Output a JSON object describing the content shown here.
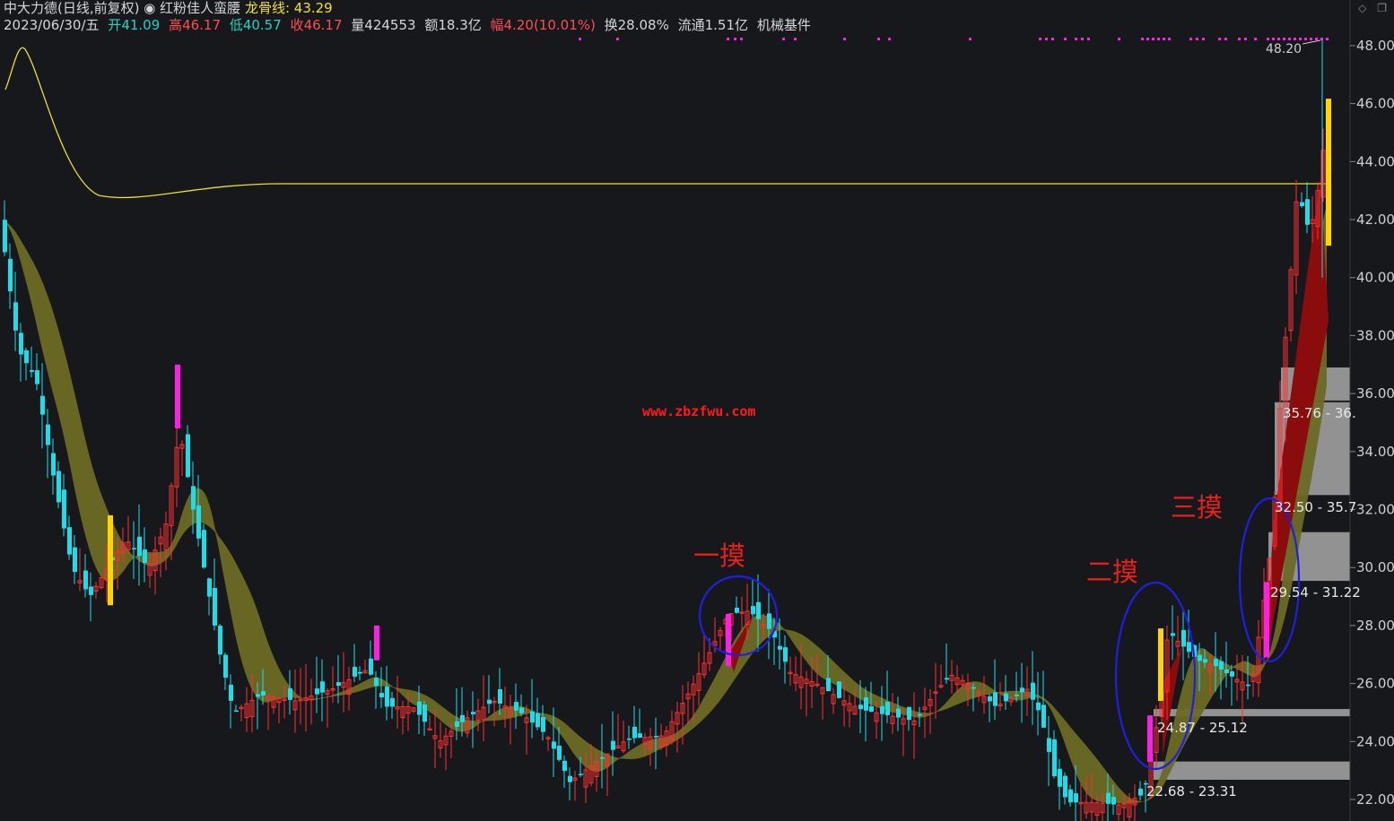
{
  "header": {
    "stock": "中大力德(日线,前复权)",
    "indicator_name": "红粉佳人蛮腰",
    "dragon_label": "龙骨线:",
    "dragon_value": "43.29",
    "date": "2023/06/30/五",
    "open_label": "开",
    "open": "41.09",
    "high_label": "高",
    "high": "46.17",
    "low_label": "低",
    "low": "40.57",
    "close_label": "收",
    "close": "46.17",
    "volume": "量424553",
    "amount": "额18.3亿",
    "change_label": "幅",
    "change": "4.20(10.01%)",
    "turnover": "换28.08%",
    "float_cap": "流通1.51亿",
    "industry": "机械基件"
  },
  "watermark": "www.zbzfwu.com",
  "annotations": [
    "一摸",
    "二摸",
    "三摸"
  ],
  "zone_labels": [
    "22.68 - 23.31",
    "24.87 - 25.12",
    "29.54 - 31.22",
    "32.50 - 35.7",
    "35.76 - 36."
  ],
  "peak_label": "48.20",
  "colors": {
    "background": "#17181c",
    "up_candle": "#ff3030",
    "down_candle": "#1fdde8",
    "ribbon": "#6b6a24",
    "ribbon_red": "#8a0c0c",
    "dragon_line": "#e8e030",
    "signal_magenta": "#ff1ee8",
    "signal_yellow": "#ffd400",
    "zone_gray": "#a8a8a8",
    "circle_blue": "#1f1fe0",
    "annotation_red": "#e8201c"
  },
  "chart_data": {
    "type": "candlestick",
    "y_axis_ticks": [
      "22.00",
      "24.00",
      "26.00",
      "28.00",
      "30.00",
      "32.00",
      "34.00",
      "36.00",
      "38.00",
      "40.00",
      "42.00",
      "44.00",
      "46.00",
      "48.00"
    ],
    "ylim": [
      21.5,
      49.5
    ],
    "dragon_line_value": 43.29,
    "last_bar": {
      "date": "2023/06/30",
      "open": 41.09,
      "high": 46.17,
      "low": 40.57,
      "close": 46.17
    },
    "peak_high": 48.2,
    "support_zones": [
      [
        22.68,
        23.31
      ],
      [
        24.87,
        25.12
      ],
      [
        29.54,
        31.22
      ],
      [
        32.5,
        35.7
      ],
      [
        35.76,
        36.9
      ]
    ],
    "close_path": [
      [
        0,
        42.0
      ],
      [
        20,
        37.5
      ],
      [
        40,
        36.5
      ],
      [
        60,
        33.0
      ],
      [
        80,
        30.0
      ],
      [
        100,
        29.0
      ],
      [
        120,
        30.0
      ],
      [
        140,
        31.0
      ],
      [
        165,
        30.0
      ],
      [
        185,
        31.5
      ],
      [
        200,
        34.8
      ],
      [
        215,
        32.0
      ],
      [
        230,
        29.5
      ],
      [
        245,
        27.0
      ],
      [
        260,
        25.0
      ],
      [
        290,
        25.6
      ],
      [
        330,
        25.4
      ],
      [
        370,
        25.8
      ],
      [
        410,
        26.5
      ],
      [
        430,
        25.2
      ],
      [
        460,
        25.2
      ],
      [
        490,
        24.0
      ],
      [
        520,
        24.8
      ],
      [
        550,
        25.4
      ],
      [
        580,
        25.0
      ],
      [
        610,
        24.2
      ],
      [
        635,
        22.6
      ],
      [
        665,
        23.3
      ],
      [
        700,
        24.1
      ],
      [
        740,
        24.2
      ],
      [
        770,
        25.8
      ],
      [
        790,
        27.0
      ],
      [
        812,
        28.4
      ],
      [
        835,
        28.5
      ],
      [
        860,
        27.8
      ],
      [
        880,
        26.4
      ],
      [
        910,
        26.0
      ],
      [
        935,
        25.5
      ],
      [
        960,
        25.1
      ],
      [
        990,
        24.9
      ],
      [
        1020,
        24.7
      ],
      [
        1045,
        25.8
      ],
      [
        1060,
        26.3
      ],
      [
        1080,
        26.0
      ],
      [
        1110,
        25.2
      ],
      [
        1145,
        25.8
      ],
      [
        1160,
        24.9
      ],
      [
        1175,
        22.8
      ],
      [
        1190,
        21.9
      ],
      [
        1220,
        21.9
      ],
      [
        1250,
        21.8
      ],
      [
        1275,
        22.2
      ],
      [
        1282,
        23.4
      ],
      [
        1293,
        25.1
      ],
      [
        1302,
        27.8
      ],
      [
        1318,
        27.3
      ],
      [
        1335,
        26.8
      ],
      [
        1355,
        26.6
      ],
      [
        1375,
        26.2
      ],
      [
        1395,
        25.9
      ],
      [
        1412,
        29.5
      ],
      [
        1419,
        31.4
      ],
      [
        1428,
        36.0
      ],
      [
        1437,
        39.5
      ],
      [
        1446,
        43.0
      ],
      [
        1460,
        41.5
      ],
      [
        1472,
        43.5
      ],
      [
        1481,
        46.17
      ]
    ],
    "signals": [
      {
        "x": 123,
        "kind": "yellow",
        "low": 28.7,
        "high": 31.8
      },
      {
        "x": 198,
        "kind": "magenta",
        "low": 34.8,
        "high": 37.0
      },
      {
        "x": 420,
        "kind": "magenta",
        "low": 26.8,
        "high": 28.0
      },
      {
        "x": 812,
        "kind": "magenta",
        "low": 26.6,
        "high": 28.4
      },
      {
        "x": 1282,
        "kind": "magenta",
        "low": 23.3,
        "high": 24.9
      },
      {
        "x": 1294,
        "kind": "yellow",
        "low": 25.4,
        "high": 27.9
      },
      {
        "x": 1412,
        "kind": "magenta",
        "low": 26.9,
        "high": 29.5
      },
      {
        "x": 1481,
        "kind": "yellow",
        "low": 41.1,
        "high": 46.17
      }
    ]
  }
}
